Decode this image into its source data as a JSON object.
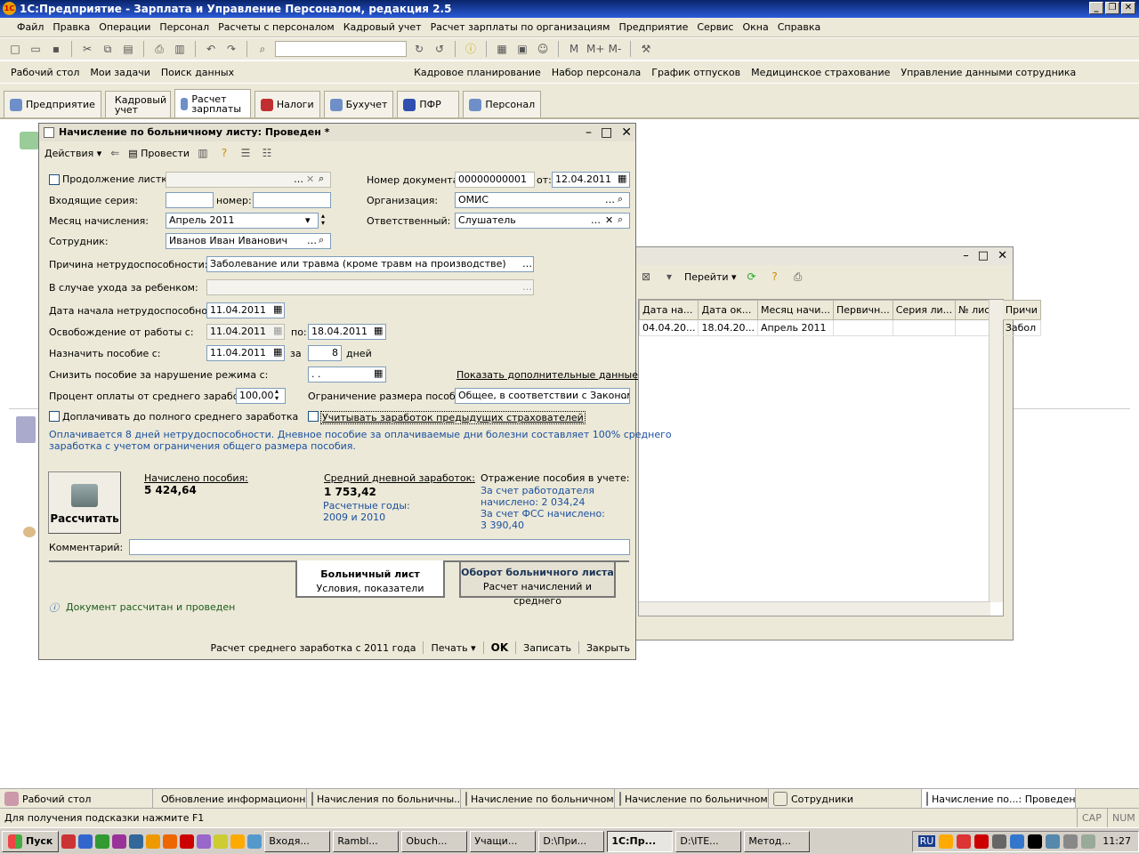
{
  "app": {
    "title": "1С:Предприятие - Зарплата и Управление Персоналом, редакция 2.5"
  },
  "menu": [
    "Файл",
    "Правка",
    "Операции",
    "Персонал",
    "Расчеты с персоналом",
    "Кадровый учет",
    "Расчет зарплаты по организациям",
    "Предприятие",
    "Сервис",
    "Окна",
    "Справка"
  ],
  "toolbar2": [
    "Рабочий стол",
    "Мои задачи",
    "Поиск данных",
    "Кадровое планирование",
    "Набор персонала",
    "График отпусков",
    "Медицинское страхование",
    "Управление данными сотрудника"
  ],
  "sections": [
    "Предприятие",
    "Кадровый учет",
    "Расчет зарплаты",
    "Налоги",
    "Бухучет",
    "ПФР",
    "Персонал"
  ],
  "bgwin": {
    "toolbar": {
      "goto": "Перейти"
    },
    "columns": [
      "Дата на...",
      "Дата ок...",
      "Месяц начи...",
      "Первичн...",
      "Серия ли...",
      "№ лис...",
      "Причи"
    ],
    "row": [
      "04.04.20...",
      "18.04.20...",
      "Апрель 2011",
      "",
      "",
      "",
      "Забол"
    ]
  },
  "dialog": {
    "title": "Начисление по больничному листу: Проведен *",
    "toolbar": {
      "actions": "Действия",
      "post": "Провести"
    },
    "labels": {
      "continuation": "Продолжение листка",
      "incoming_series": "Входящие серия:",
      "number": "номер:",
      "accrual_month": "Месяц начисления:",
      "employee": "Сотрудник:",
      "doc_number": "Номер документа:",
      "from": "от:",
      "organization": "Организация:",
      "responsible": "Ответственный:",
      "reason": "Причина нетрудоспособности:",
      "child_care": "В случае ухода за ребенком:",
      "start_date": "Дата начала нетрудоспособности:",
      "release": "Освобождение от работы с:",
      "to": "по:",
      "assign": "Назначить пособие с:",
      "for": "за",
      "days": "дней",
      "reduce": "Снизить пособие за нарушение режима с:",
      "show_more": "Показать дополнительные данные",
      "percent": "Процент оплаты от среднего заработка:",
      "limit": "Ограничение размера пособия:",
      "topup": "Доплачивать до полного среднего заработка",
      "prev_insurers": "Учитывать заработок предыдущих страхователей",
      "comment": "Комментарий:"
    },
    "values": {
      "accrual_month": "Апрель 2011",
      "employee": "Иванов Иван Иванович",
      "doc_number": "00000000001",
      "doc_date": "12.04.2011",
      "organization": "ОМИС",
      "responsible": "Слушатель",
      "reason": "Заболевание или травма (кроме травм на производстве)",
      "start_date": "11.04.2011",
      "release_from": "11.04.2011",
      "release_to": "18.04.2011",
      "assign_from": "11.04.2011",
      "days": "8",
      "reduce_date": " .  .",
      "percent": "100,00",
      "limit": "Общее, в соответствии с Законом"
    },
    "info_line1": "Оплачивается 8 дней нетрудоспособности. Дневное пособие за оплачиваемые дни болезни составляет 100% среднего",
    "info_line2": "заработка с учетом ограничения общего размера пособия.",
    "calc_button": "Рассчитать",
    "results": {
      "accrued_label": "Начислено пособия:",
      "accrued_value": "5 424,64",
      "avg_label": "Средний дневной заработок:",
      "avg_value": "1 753,42",
      "years_label": "Расчетные годы:",
      "years_value": "2009 и 2010",
      "reflect_label": "Отражение пособия в учете:",
      "employer_line1": "За счет работодателя",
      "employer_line2": "начислено: 2 034,24",
      "fss_line1": "За счет ФСС начислено:",
      "fss_line2": "3 390,40"
    },
    "tabs": [
      {
        "title": "Больничный лист",
        "subtitle": "Условия, показатели"
      },
      {
        "title": "Оборот больничного листа",
        "subtitle": "Расчет начислений и среднего"
      }
    ],
    "status_msg": "Документ рассчитан и проведен",
    "bottom": {
      "avg_calc": "Расчет среднего заработка с 2011 года",
      "print": "Печать",
      "ok": "OK",
      "save": "Записать",
      "close": "Закрыть"
    }
  },
  "window_tabs": [
    "Рабочий стол",
    "Обновление информационн...",
    "Начисления по больничны...",
    "Начисление по больничном...",
    "Начисление по больничном...",
    "Сотрудники",
    "Начисление по...: Проведен *"
  ],
  "status": {
    "hint": "Для получения подсказки нажмите F1",
    "cap": "CAP",
    "num": "NUM"
  },
  "os": {
    "start": "Пуск",
    "tasks": [
      "Входя...",
      "Rambl...",
      "Obuch...",
      "Учащи...",
      "D:\\При...",
      "1С:Пр...",
      "D:\\ITE...",
      "Метод..."
    ],
    "lang": "RU",
    "clock": "11:27"
  }
}
